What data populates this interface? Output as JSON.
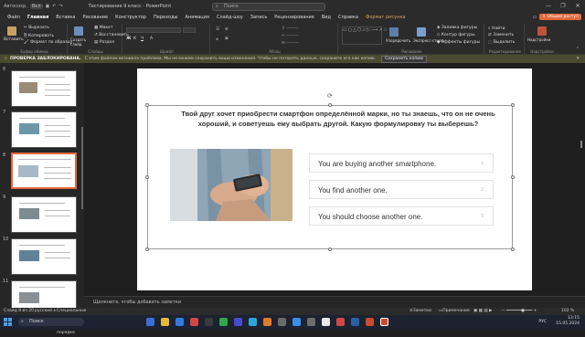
{
  "titlebar": {
    "app_icon": "powerpoint-icon",
    "autosave": "Вкл",
    "title": "Тестирование 9 класс - PowerPoint",
    "search_placeholder": "Поиск"
  },
  "tabs": [
    {
      "label": "Файл"
    },
    {
      "label": "Главная",
      "active": true
    },
    {
      "label": "Вставка"
    },
    {
      "label": "Рисование"
    },
    {
      "label": "Конструктор"
    },
    {
      "label": "Переходы"
    },
    {
      "label": "Анимация"
    },
    {
      "label": "Слайд-шоу"
    },
    {
      "label": "Запись"
    },
    {
      "label": "Рецензирование"
    },
    {
      "label": "Вид"
    },
    {
      "label": "Справка"
    },
    {
      "label": "Формат рисунка",
      "accent": true
    }
  ],
  "share_label": "Общий доступ",
  "ribbon": {
    "paste": "Вставить",
    "cut": "Вырезать",
    "copy": "Копировать",
    "format_painter": "Формат по образцу",
    "clipboard_group": "Буфер обмена",
    "new_slide": "Создать слайд",
    "reuse_slides": "Повторное использование слайдов",
    "layout": "Макет",
    "reset": "Восстановить",
    "section": "Раздел",
    "slides_group": "Слайды",
    "font_group": "Шрифт",
    "paragraph_group": "Абзац",
    "drawing_group": "Рисование",
    "arrange": "Упорядочить",
    "quick_styles": "Экспресс-стили",
    "shape_fill": "Заливка фигуры",
    "shape_outline": "Контур фигуры",
    "shape_effects": "Эффекты фигуры",
    "find": "Найти",
    "replace": "Заменить",
    "select": "Выделить",
    "editing_group": "Редактирование",
    "addins": "Надстройки",
    "addins_group": "Надстройки"
  },
  "warning": {
    "title": "ПРОВЕРКА ЗАБЛОКИРОВАНА.",
    "message": "С этим файлом возникла проблема. Мы не можем сохранить ваши изменения. Чтобы не потерять данные, сохраните его как копию.",
    "button": "Сохранить копию"
  },
  "thumbnails": [
    {
      "num": "6"
    },
    {
      "num": "7"
    },
    {
      "num": "8",
      "selected": true
    },
    {
      "num": "9"
    },
    {
      "num": "10"
    },
    {
      "num": "11"
    }
  ],
  "slide": {
    "question": "Твой друг хочет приобрести смартфон определённой марки, но ты знаешь, что он не очень хороший, и советуешь ему выбрать другой. Какую формулировку ты выберешь?",
    "options": [
      {
        "text": "You are buying another smartphone.",
        "num": "1"
      },
      {
        "text": "You find another one.",
        "num": "2"
      },
      {
        "text": "You should choose another one.",
        "num": "3"
      }
    ]
  },
  "notes_placeholder": "Щелкните, чтобы добавить заметки",
  "statusbar": {
    "slide_info": "Слайд 8 из 20",
    "language": "русский",
    "accessibility": "Специальные возможности: все в порядке",
    "notes": "Заметки",
    "comments": "Примечания",
    "zoom": "102 %"
  },
  "taskbar": {
    "search_placeholder": "Поиск",
    "lang": "РУС",
    "time": "13:15",
    "date": "15.05.2024"
  },
  "colors": {
    "accent": "#e3683e",
    "warning_bg": "#4a4a2e"
  }
}
